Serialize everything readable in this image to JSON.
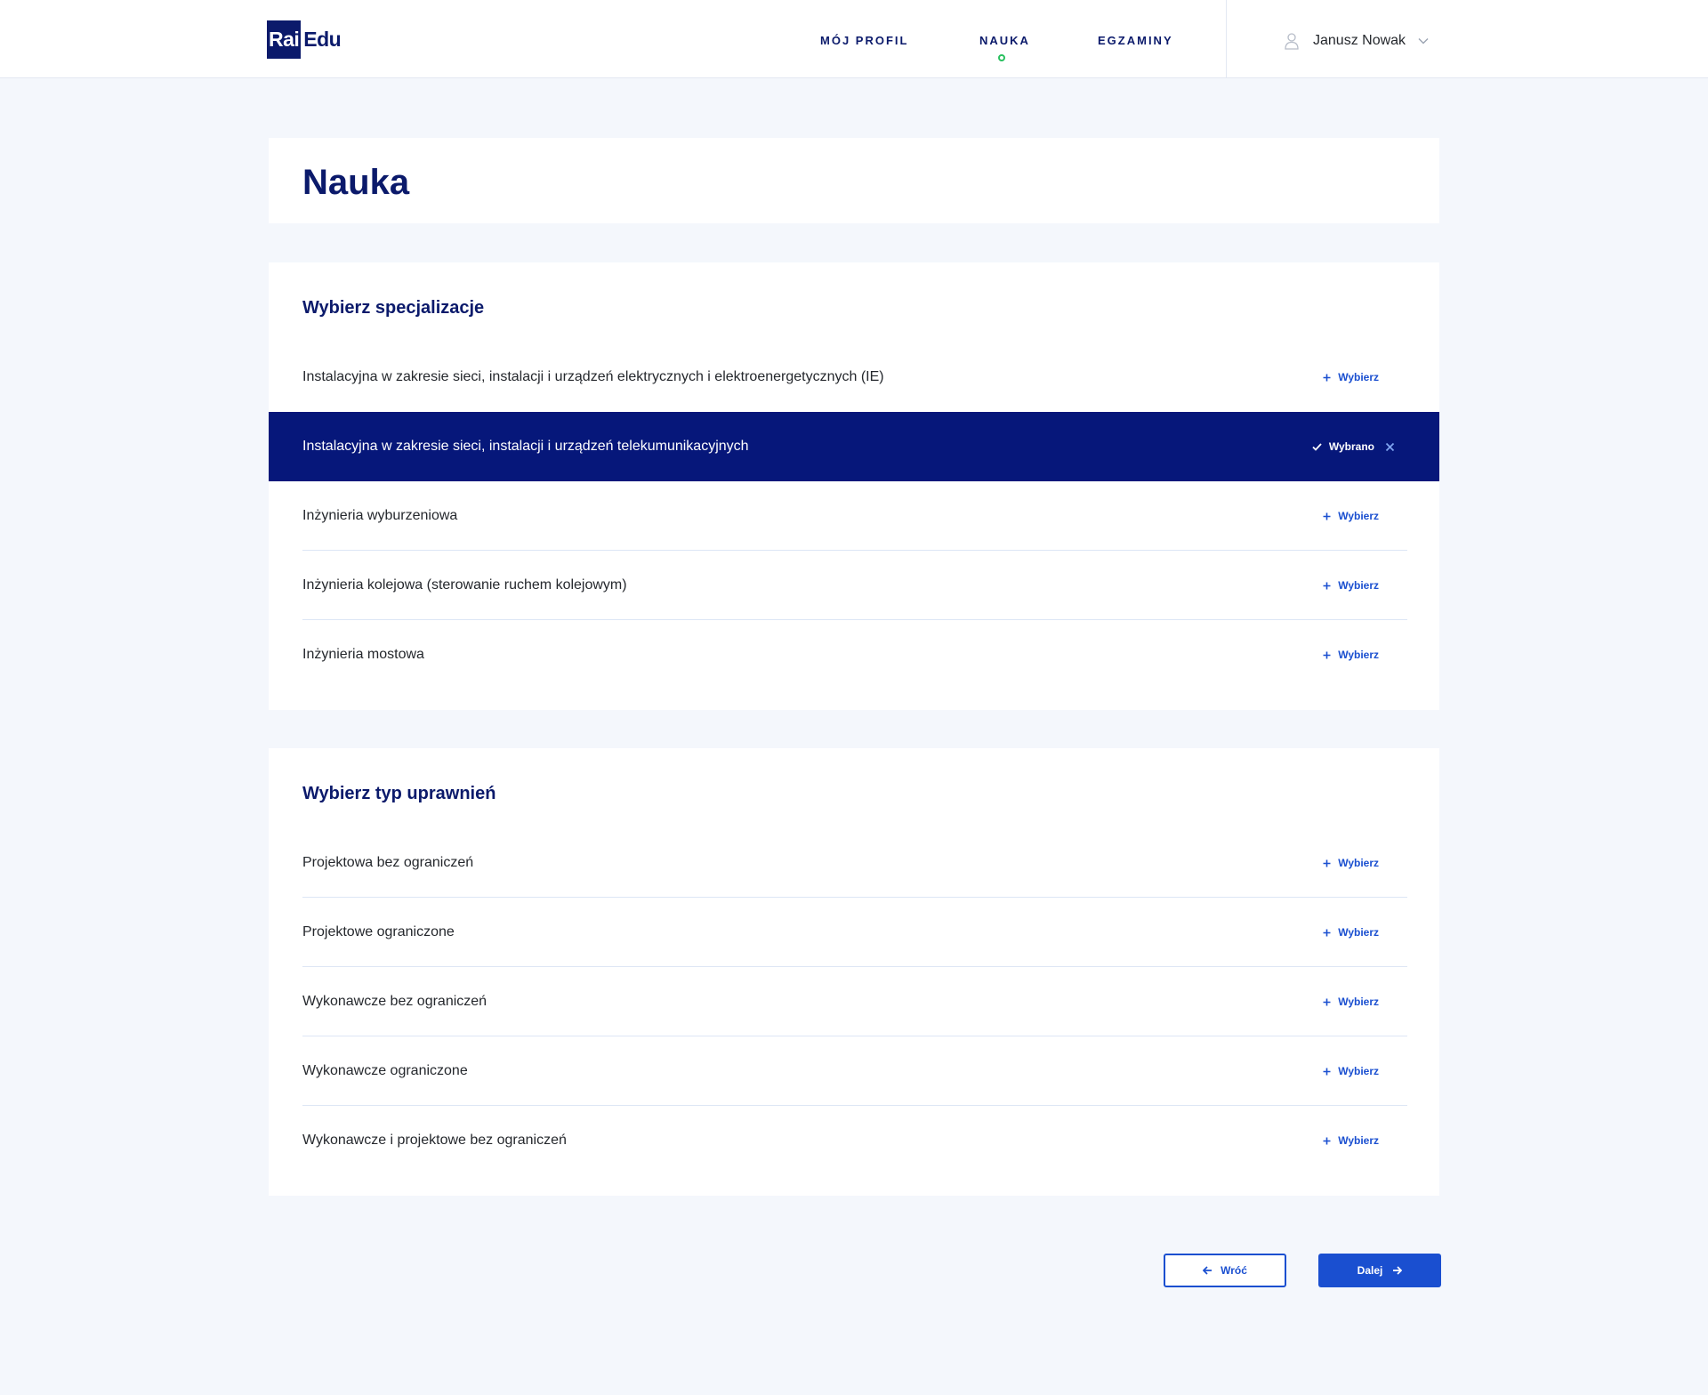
{
  "logo": {
    "box_text": "Rai",
    "text": "Edu"
  },
  "nav": {
    "items": [
      {
        "label": "MÓJ PROFIL"
      },
      {
        "label": "NAUKA"
      },
      {
        "label": "EGZAMINY"
      }
    ],
    "active": "NAUKA"
  },
  "user": {
    "name": "Janusz Nowak",
    "icon": "user-icon"
  },
  "page": {
    "title": "Nauka"
  },
  "specializations": {
    "title": "Wybierz specjalizacje",
    "select_label": "Wybierz",
    "selected_label": "Wybrano",
    "items": [
      {
        "label": "Instalacyjna w zakresie sieci, instalacji i urządzeń elektrycznych i elektroenergetycznych (IE)",
        "selected": false
      },
      {
        "label": "Instalacyjna w zakresie sieci, instalacji i urządzeń telekumunikacyjnych",
        "selected": true
      },
      {
        "label": "Inżynieria wyburzeniowa",
        "selected": false
      },
      {
        "label": "Inżynieria kolejowa (sterowanie ruchem kolejowym)",
        "selected": false
      },
      {
        "label": "Inżynieria mostowa",
        "selected": false
      }
    ]
  },
  "permissions": {
    "title": "Wybierz typ uprawnień",
    "select_label": "Wybierz",
    "items": [
      {
        "label": "Projektowa bez ograniczeń"
      },
      {
        "label": "Projektowe ograniczone"
      },
      {
        "label": "Wykonawcze bez ograniczeń"
      },
      {
        "label": "Wykonawcze ograniczone"
      },
      {
        "label": "Wykonawcze i projektowe bez ograniczeń"
      }
    ]
  },
  "buttons": {
    "back": "Wróć",
    "next": "Dalej"
  },
  "colors": {
    "primary_dark": "#0b1a6b",
    "selected_row": "#06177a",
    "accent_blue": "#1a4fd0",
    "active_dot": "#29c05f",
    "background": "#f4f7fc"
  }
}
